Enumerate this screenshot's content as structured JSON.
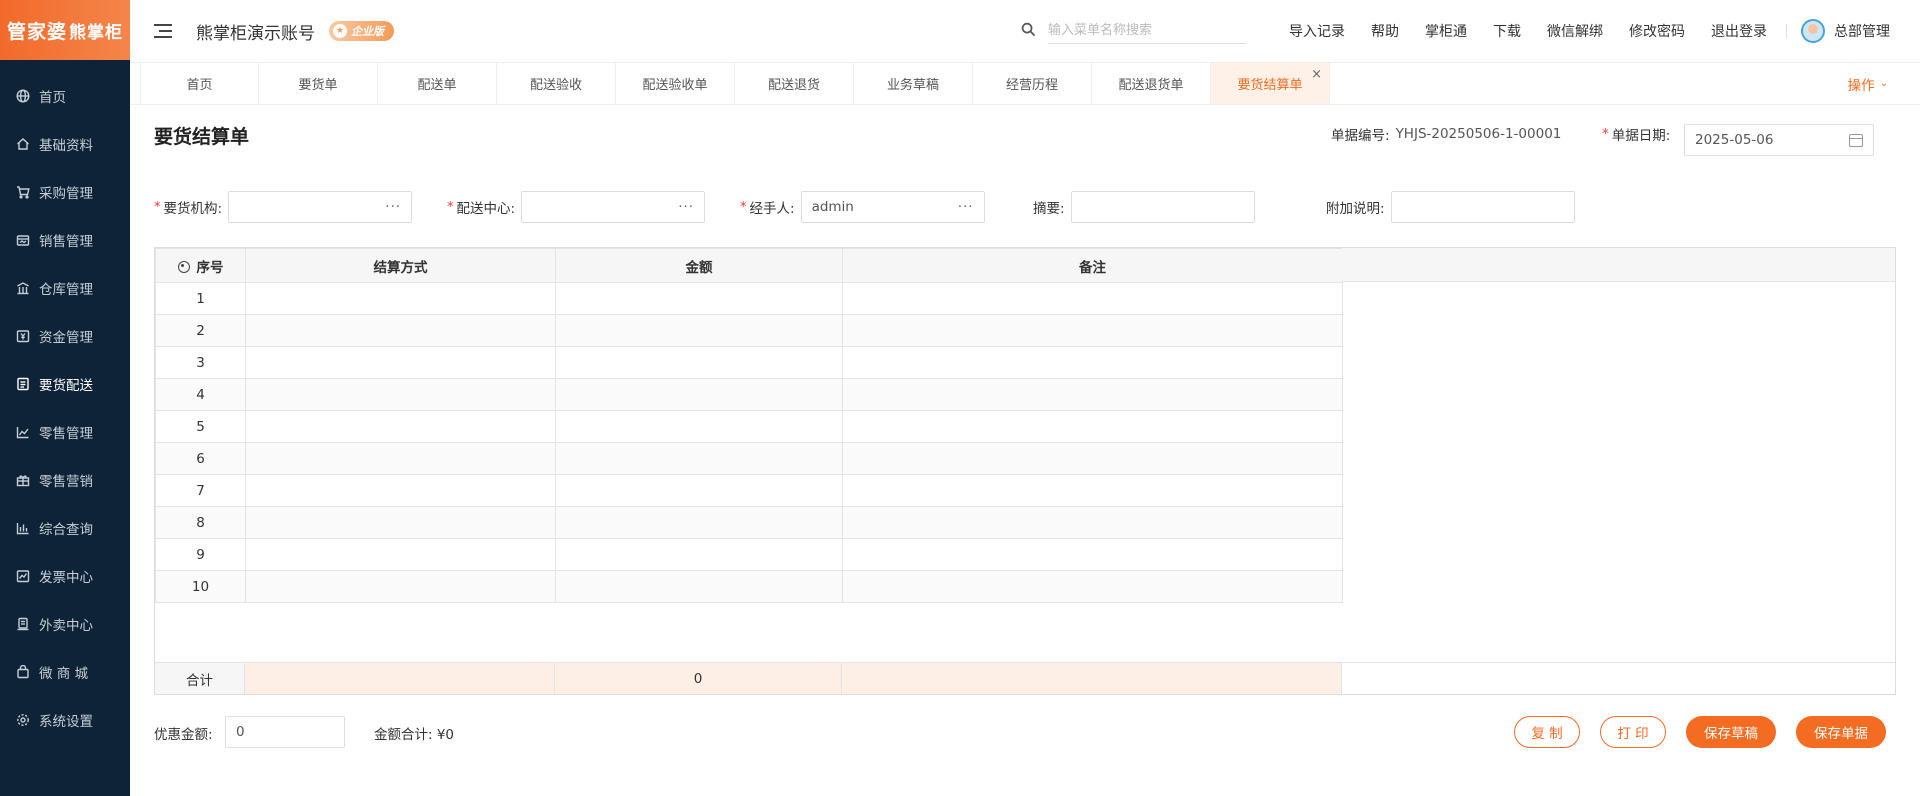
{
  "logo": {
    "brand_left": "管家婆",
    "brand_right": "熊掌柜"
  },
  "sidebar": {
    "items": [
      {
        "label": "首页",
        "icon": "globe-icon"
      },
      {
        "label": "基础资料",
        "icon": "home-icon"
      },
      {
        "label": "采购管理",
        "icon": "cart-icon"
      },
      {
        "label": "销售管理",
        "icon": "sales-icon"
      },
      {
        "label": "仓库管理",
        "icon": "warehouse-icon"
      },
      {
        "label": "资金管理",
        "icon": "money-icon"
      },
      {
        "label": "要货配送",
        "icon": "document-icon"
      },
      {
        "label": "零售管理",
        "icon": "chart-icon"
      },
      {
        "label": "零售营销",
        "icon": "gift-icon"
      },
      {
        "label": "综合查询",
        "icon": "bar-chart-icon"
      },
      {
        "label": "发票中心",
        "icon": "invoice-icon"
      },
      {
        "label": "外卖中心",
        "icon": "delivery-icon"
      },
      {
        "label": "微 商 城",
        "icon": "shop-icon"
      },
      {
        "label": "系统设置",
        "icon": "gear-icon"
      }
    ],
    "active_index": 6
  },
  "header": {
    "account_title": "熊掌柜演示账号",
    "edition_badge": "企业版",
    "search_placeholder": "输入菜单名称搜索",
    "links": [
      "导入记录",
      "帮助",
      "掌柜通",
      "下载",
      "微信解绑",
      "修改密码",
      "退出登录"
    ],
    "user_name": "总部管理"
  },
  "tabs": {
    "items": [
      "首页",
      "要货单",
      "配送单",
      "配送验收",
      "配送验收单",
      "配送退货",
      "业务草稿",
      "经营历程",
      "配送退货单",
      "要货结算单"
    ],
    "active_index": 9,
    "ops_label": "操作"
  },
  "page": {
    "title": "要货结算单",
    "doc_no_label": "单据编号:",
    "doc_no": "YHJS-20250506-1-00001",
    "date_label": "单据日期:",
    "date": "2025-05-06"
  },
  "form": {
    "org_label": "要货机构:",
    "org_value": "",
    "center_label": "配送中心:",
    "center_value": "",
    "handler_label": "经手人:",
    "handler_value": "admin",
    "summary_label": "摘要:",
    "summary_value": "",
    "note_label": "附加说明:",
    "note_value": ""
  },
  "table": {
    "headers": [
      "序号",
      "结算方式",
      "金额",
      "备注"
    ],
    "rows": [
      [
        "1",
        "",
        "",
        ""
      ],
      [
        "2",
        "",
        "",
        ""
      ],
      [
        "3",
        "",
        "",
        ""
      ],
      [
        "4",
        "",
        "",
        ""
      ],
      [
        "5",
        "",
        "",
        ""
      ],
      [
        "6",
        "",
        "",
        ""
      ],
      [
        "7",
        "",
        "",
        ""
      ],
      [
        "8",
        "",
        "",
        ""
      ],
      [
        "9",
        "",
        "",
        ""
      ],
      [
        "10",
        "",
        "",
        ""
      ]
    ],
    "total_label": "合计",
    "total_amount": "0"
  },
  "footer": {
    "discount_label": "优惠金额:",
    "discount_value": "0",
    "sum_label": "金额合计: ¥0",
    "buttons": {
      "copy": "复 制",
      "print": "打 印",
      "save_draft": "保存草稿",
      "save_doc": "保存单据"
    }
  },
  "colors": {
    "accent": "#f36c22",
    "sidebar_bg": "#0e2338",
    "tab_active_bg": "#fdf1e8",
    "total_row_bg": "#fdefe6"
  }
}
